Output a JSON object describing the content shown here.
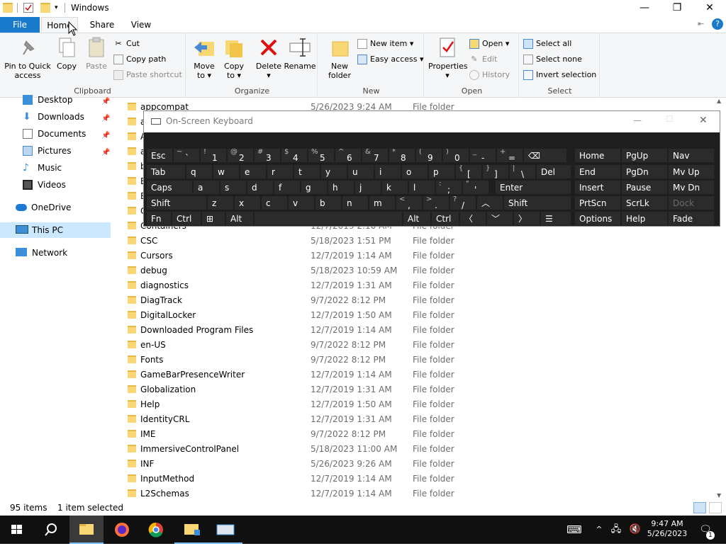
{
  "window": {
    "title": "Windows"
  },
  "ribbon_tabs": {
    "file": "File",
    "home": "Home",
    "share": "Share",
    "view": "View"
  },
  "ribbon": {
    "clipboard": {
      "label": "Clipboard",
      "pin": "Pin to Quick access",
      "copy": "Copy",
      "paste": "Paste",
      "cut": "Cut",
      "copy_path": "Copy path",
      "paste_shortcut": "Paste shortcut"
    },
    "organize": {
      "label": "Organize",
      "move_to": "Move to",
      "copy_to": "Copy to",
      "delete": "Delete",
      "rename": "Rename"
    },
    "new": {
      "label": "New",
      "new_folder": "New folder",
      "new_item": "New item",
      "easy_access": "Easy access"
    },
    "open": {
      "label": "Open",
      "properties": "Properties",
      "open": "Open",
      "edit": "Edit",
      "history": "History"
    },
    "select": {
      "label": "Select",
      "select_all": "Select all",
      "select_none": "Select none",
      "invert": "Invert selection"
    }
  },
  "nav": {
    "desktop": "Desktop",
    "downloads": "Downloads",
    "documents": "Documents",
    "pictures": "Pictures",
    "music": "Music",
    "videos": "Videos",
    "onedrive": "OneDrive",
    "thispc": "This PC",
    "network": "Network"
  },
  "files": [
    {
      "name": "appcompat",
      "date": "5/26/2023 9:24 AM",
      "type": "File folder"
    },
    {
      "name": "a",
      "date": "",
      "type": ""
    },
    {
      "name": "A",
      "date": "",
      "type": ""
    },
    {
      "name": "a",
      "date": "",
      "type": ""
    },
    {
      "name": "b",
      "date": "",
      "type": ""
    },
    {
      "name": "B",
      "date": "",
      "type": ""
    },
    {
      "name": "B",
      "date": "",
      "type": ""
    },
    {
      "name": "C",
      "date": "",
      "type": ""
    },
    {
      "name": "Containers",
      "date": "12/7/2019 2:10 AM",
      "type": "File folder"
    },
    {
      "name": "CSC",
      "date": "5/18/2023 1:51 PM",
      "type": "File folder"
    },
    {
      "name": "Cursors",
      "date": "12/7/2019 1:14 AM",
      "type": "File folder"
    },
    {
      "name": "debug",
      "date": "5/18/2023 10:59 AM",
      "type": "File folder"
    },
    {
      "name": "diagnostics",
      "date": "12/7/2019 1:31 AM",
      "type": "File folder"
    },
    {
      "name": "DiagTrack",
      "date": "9/7/2022 8:12 PM",
      "type": "File folder"
    },
    {
      "name": "DigitalLocker",
      "date": "12/7/2019 1:50 AM",
      "type": "File folder"
    },
    {
      "name": "Downloaded Program Files",
      "date": "12/7/2019 1:14 AM",
      "type": "File folder"
    },
    {
      "name": "en-US",
      "date": "9/7/2022 8:12 PM",
      "type": "File folder"
    },
    {
      "name": "Fonts",
      "date": "9/7/2022 8:12 PM",
      "type": "File folder"
    },
    {
      "name": "GameBarPresenceWriter",
      "date": "12/7/2019 1:14 AM",
      "type": "File folder"
    },
    {
      "name": "Globalization",
      "date": "12/7/2019 1:31 AM",
      "type": "File folder"
    },
    {
      "name": "Help",
      "date": "12/7/2019 1:50 AM",
      "type": "File folder"
    },
    {
      "name": "IdentityCRL",
      "date": "12/7/2019 1:31 AM",
      "type": "File folder"
    },
    {
      "name": "IME",
      "date": "9/7/2022 8:12 PM",
      "type": "File folder"
    },
    {
      "name": "ImmersiveControlPanel",
      "date": "5/18/2023 11:00 AM",
      "type": "File folder"
    },
    {
      "name": "INF",
      "date": "5/26/2023 9:26 AM",
      "type": "File folder"
    },
    {
      "name": "InputMethod",
      "date": "12/7/2019 1:14 AM",
      "type": "File folder"
    },
    {
      "name": "L2Schemas",
      "date": "12/7/2019 1:14 AM",
      "type": "File folder"
    }
  ],
  "status": {
    "count": "95 items",
    "selected": "1 item selected"
  },
  "osk": {
    "title": "On-Screen Keyboard",
    "row1": [
      {
        "s": "~",
        "m": "`"
      },
      {
        "s": "!",
        "m": "1"
      },
      {
        "s": "@",
        "m": "2"
      },
      {
        "s": "#",
        "m": "3"
      },
      {
        "s": "$",
        "m": "4"
      },
      {
        "s": "%",
        "m": "5"
      },
      {
        "s": "^",
        "m": "6"
      },
      {
        "s": "&",
        "m": "7"
      },
      {
        "s": "*",
        "m": "8"
      },
      {
        "s": "(",
        "m": "9"
      },
      {
        "s": ")",
        "m": "0"
      },
      {
        "s": "_",
        "m": "-"
      },
      {
        "s": "+",
        "m": "="
      }
    ],
    "row2": [
      "q",
      "w",
      "e",
      "r",
      "t",
      "y",
      "u",
      "i",
      "o",
      "p"
    ],
    "row2b": [
      {
        "s": "{",
        "m": "["
      },
      {
        "s": "}",
        "m": "]"
      },
      {
        "s": "|",
        "m": "\\"
      }
    ],
    "row3": [
      "a",
      "s",
      "d",
      "f",
      "g",
      "h",
      "j",
      "k",
      "l"
    ],
    "row3b": [
      {
        "s": ":",
        "m": ";"
      },
      {
        "s": "\"",
        "m": "'"
      }
    ],
    "row4": [
      "z",
      "x",
      "c",
      "v",
      "b",
      "n",
      "m"
    ],
    "row4b": [
      {
        "s": "<",
        "m": ","
      },
      {
        "s": ">",
        "m": "."
      },
      {
        "s": "?",
        "m": "/"
      }
    ],
    "esc": "Esc",
    "tab": "Tab",
    "caps": "Caps",
    "shift": "Shift",
    "fn": "Fn",
    "ctrl": "Ctrl",
    "alt": "Alt",
    "del": "Del",
    "enter": "Enter",
    "home": "Home",
    "pgup": "PgUp",
    "nav": "Nav",
    "end": "End",
    "pgdn": "PgDn",
    "mvup": "Mv Up",
    "insert": "Insert",
    "pause": "Pause",
    "mvdn": "Mv Dn",
    "prtscn": "PrtScn",
    "scrlk": "ScrLk",
    "dock": "Dock",
    "options": "Options",
    "help": "Help",
    "fade": "Fade"
  },
  "clock": {
    "time": "9:47 AM",
    "date": "5/26/2023"
  },
  "notifications": "1"
}
